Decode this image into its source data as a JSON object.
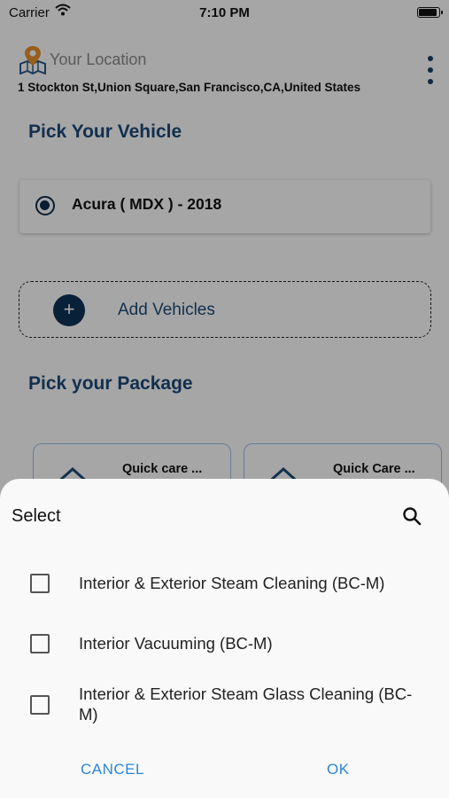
{
  "status_bar": {
    "carrier": "Carrier",
    "time": "7:10 PM",
    "battery_level": 0.95
  },
  "location": {
    "title": "Your Location",
    "address": "1 Stockton St,Union Square,San Francisco,CA,United States",
    "icon": "map-pin-icon"
  },
  "vehicle_section": {
    "title": "Pick Your Vehicle",
    "selected_vehicle": "Acura ( MDX ) - 2018",
    "add_label": "Add Vehicles"
  },
  "package_section": {
    "title": "Pick your Package",
    "packages": [
      {
        "name": "Quick care ..."
      },
      {
        "name": "Quick Care ..."
      }
    ]
  },
  "select_sheet": {
    "title": "Select",
    "options": [
      {
        "label": "Interior & Exterior Steam Cleaning (BC-M)",
        "checked": false
      },
      {
        "label": "Interior Vacuuming (BC-M)",
        "checked": false
      },
      {
        "label": "Interior & Exterior Steam Glass Cleaning (BC-M)",
        "checked": false
      }
    ],
    "cancel_label": "CANCEL",
    "ok_label": "OK"
  },
  "colors": {
    "primary_navy": "#1d4a7a",
    "button_blue": "#2a86d8",
    "pin_orange": "#e8912d"
  }
}
